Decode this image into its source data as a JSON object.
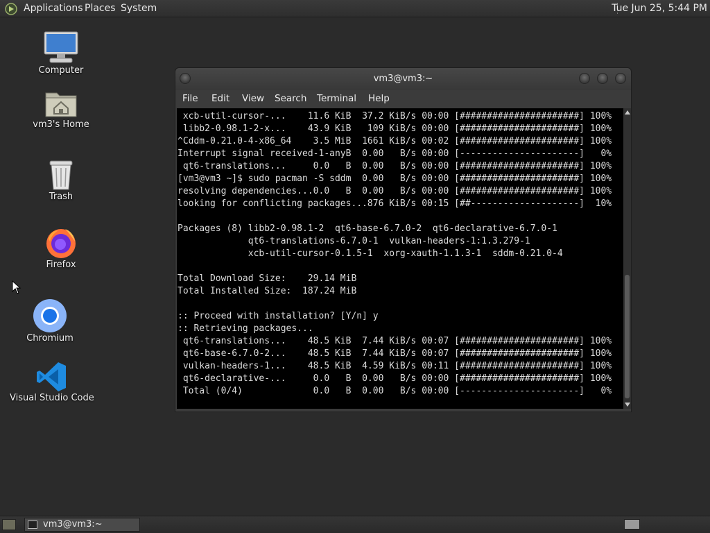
{
  "top_panel": {
    "menus": [
      "Applications",
      "Places",
      "System"
    ],
    "clock": "Tue Jun 25,  5:44 PM"
  },
  "desktop": {
    "icons": [
      {
        "label": "Computer",
        "icon": "computer-icon"
      },
      {
        "label": "vm3's Home",
        "icon": "home-folder-icon"
      },
      {
        "label": "Trash",
        "icon": "trash-icon"
      },
      {
        "label": "Firefox",
        "icon": "firefox-icon"
      },
      {
        "label": "Chromium",
        "icon": "chromium-icon"
      },
      {
        "label": "Visual Studio Code",
        "icon": "vscode-icon"
      }
    ]
  },
  "terminal": {
    "title": "vm3@vm3:~",
    "menu": [
      "File",
      "Edit",
      "View",
      "Search",
      "Terminal",
      "Help"
    ],
    "lines": [
      " xcb-util-cursor-...    11.6 KiB  37.2 KiB/s 00:00 [######################] 100%",
      " libb2-0.98.1-2-x...    43.9 KiB   109 KiB/s 00:00 [######################] 100%",
      "^Cddm-0.21.0-4-x86_64    3.5 MiB  1661 KiB/s 00:02 [######################] 100%",
      "Interrupt signal received-1-anyB  0.00   B/s 00:00 [----------------------]   0%",
      " qt6-translations...     0.0   B  0.00   B/s 00:00 [######################] 100%",
      "[vm3@vm3 ~]$ sudo pacman -S sddm  0.00   B/s 00:00 [######################] 100%",
      "resolving dependencies...0.0   B  0.00   B/s 00:00 [######################] 100%",
      "looking for conflicting packages...876 KiB/s 00:15 [##--------------------]  10%",
      "",
      "Packages (8) libb2-0.98.1-2  qt6-base-6.7.0-2  qt6-declarative-6.7.0-1",
      "             qt6-translations-6.7.0-1  vulkan-headers-1:1.3.279-1",
      "             xcb-util-cursor-0.1.5-1  xorg-xauth-1.1.3-1  sddm-0.21.0-4",
      "",
      "Total Download Size:    29.14 MiB",
      "Total Installed Size:  187.24 MiB",
      "",
      ":: Proceed with installation? [Y/n] y",
      ":: Retrieving packages...",
      " qt6-translations...    48.5 KiB  7.44 KiB/s 00:07 [######################] 100%",
      " qt6-base-6.7.0-2...    48.5 KiB  7.44 KiB/s 00:07 [######################] 100%",
      " vulkan-headers-1...    48.5 KiB  4.59 KiB/s 00:11 [######################] 100%",
      " qt6-declarative-...     0.0   B  0.00   B/s 00:00 [######################] 100%",
      " Total (0/4)             0.0   B  0.00   B/s 00:00 [----------------------]   0%"
    ]
  },
  "taskbar": {
    "tasks": [
      {
        "label": "vm3@vm3:~",
        "icon": "terminal-icon"
      }
    ]
  },
  "colors": {
    "desktop_bg": "#2b2b2b",
    "terminal_bg": "#000000",
    "terminal_fg": "#dcdcdc",
    "chromium_blue": "#1a73e8",
    "vscode_blue": "#1e8be0"
  }
}
